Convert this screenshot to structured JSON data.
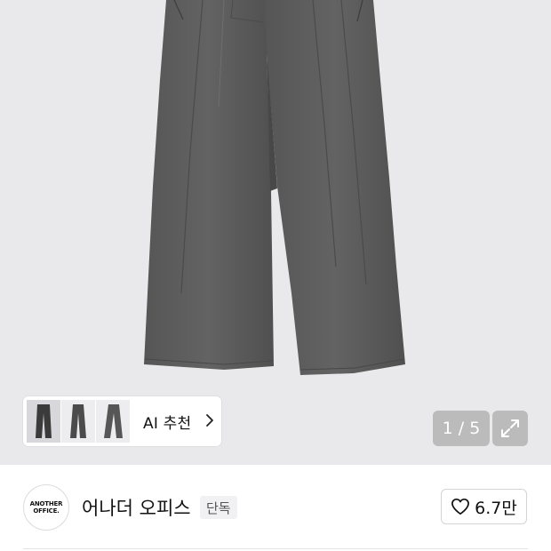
{
  "gallery": {
    "image_description_icon": "trousers-photo",
    "page_indicator": "1 / 5",
    "expand_icon": "expand-arrows-icon"
  },
  "ai_recommend": {
    "label": "AI 추천",
    "thumbnail_count": 3,
    "chevron_icon": "chevron-right-icon"
  },
  "brand": {
    "logo_line1": "ANOTHER",
    "logo_line2": "OFFICE.",
    "name": "어나더 오피스",
    "badge": "단독"
  },
  "like": {
    "icon": "heart-icon",
    "count": "6.7만"
  },
  "colors": {
    "hero_bg": "#e9e9eb",
    "garment": "#5b5c5b",
    "overlay": "rgba(150,150,150,0.55)"
  }
}
